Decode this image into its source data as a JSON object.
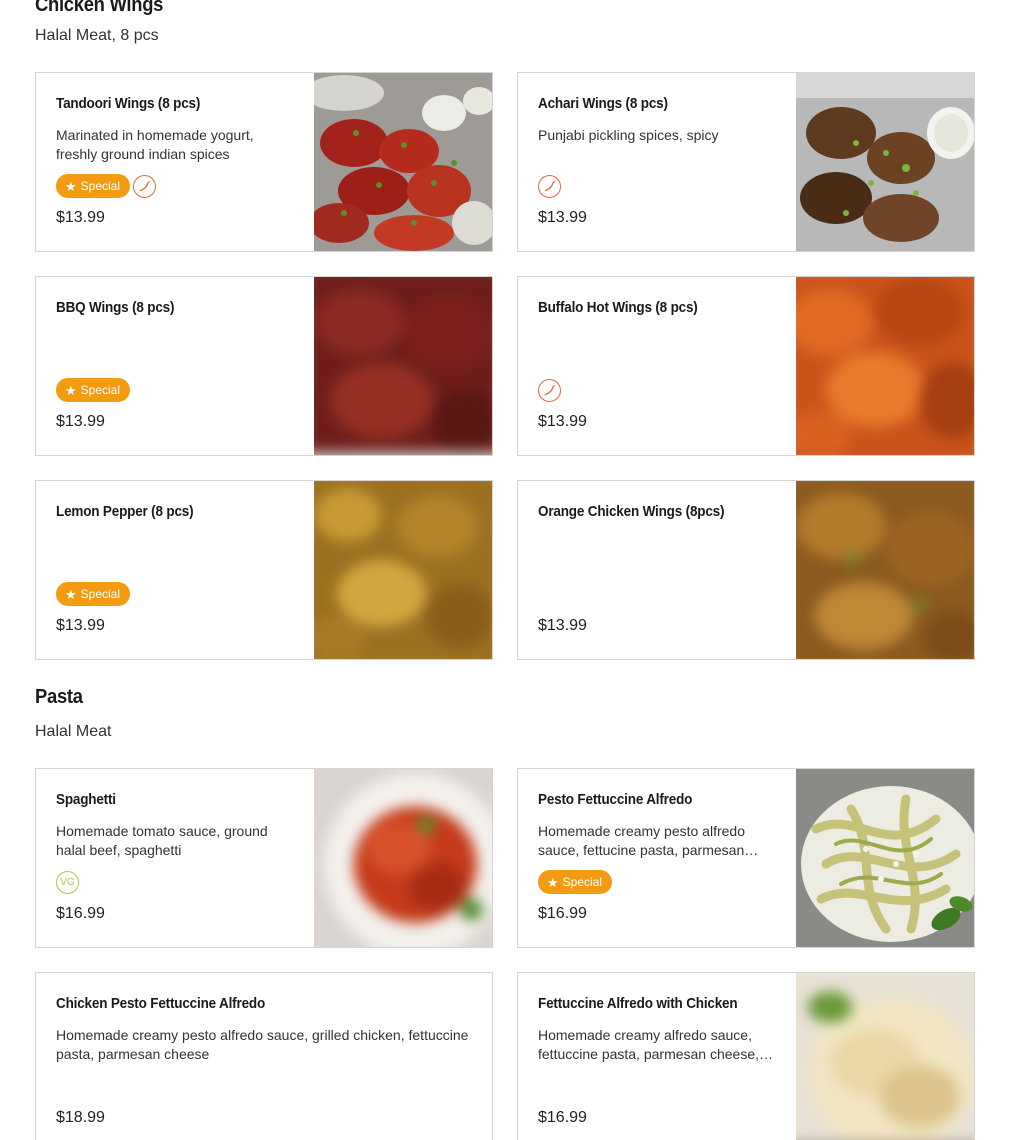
{
  "sections": [
    {
      "title": "Chicken Wings",
      "subtitle": "Halal Meat, 8 pcs"
    },
    {
      "title": "Pasta",
      "subtitle": "Halal Meat"
    }
  ],
  "items": [
    {
      "name": "Tandoori Wings (8 pcs)",
      "desc": "Marinated in homemade yogurt, freshly ground indian spices",
      "price": "$13.99",
      "special": "Special",
      "spicy": true
    },
    {
      "name": "Achari Wings (8 pcs)",
      "desc": "Punjabi pickling spices, spicy",
      "price": "$13.99",
      "spicy": true
    },
    {
      "name": "BBQ Wings (8 pcs)",
      "desc": "",
      "price": "$13.99",
      "special": "Special"
    },
    {
      "name": "Buffalo Hot Wings (8 pcs)",
      "desc": "",
      "price": "$13.99",
      "spicy": true
    },
    {
      "name": "Lemon Pepper (8 pcs)",
      "desc": "",
      "price": "$13.99",
      "special": "Special"
    },
    {
      "name": "Orange Chicken Wings (8pcs)",
      "desc": "",
      "price": "$13.99"
    },
    {
      "name": "Spaghetti",
      "desc": "Homemade tomato sauce, ground halal beef, spaghetti",
      "price": "$16.99",
      "vg": "VG"
    },
    {
      "name": "Pesto Fettuccine Alfredo",
      "desc": "Homemade creamy pesto alfredo sauce, fettucine pasta, parmesan…",
      "price": "$16.99",
      "special": "Special"
    },
    {
      "name": "Chicken Pesto Fettuccine Alfredo",
      "desc": "Homemade creamy pesto alfredo sauce, grilled chicken, fettuccine pasta, parmesan cheese",
      "price": "$18.99"
    },
    {
      "name": "Fettuccine Alfredo with Chicken",
      "desc": "Homemade creamy alfredo sauce, fettuccine pasta, parmesan cheese,…",
      "price": "$16.99"
    }
  ],
  "icons": {
    "special": "star-icon",
    "spicy": "chili-pepper-icon",
    "vegetarian": "vg-icon"
  },
  "colors": {
    "special_badge": "#f39c12",
    "spicy_icon": "#e0693a",
    "vg_icon": "#a9c94a"
  }
}
